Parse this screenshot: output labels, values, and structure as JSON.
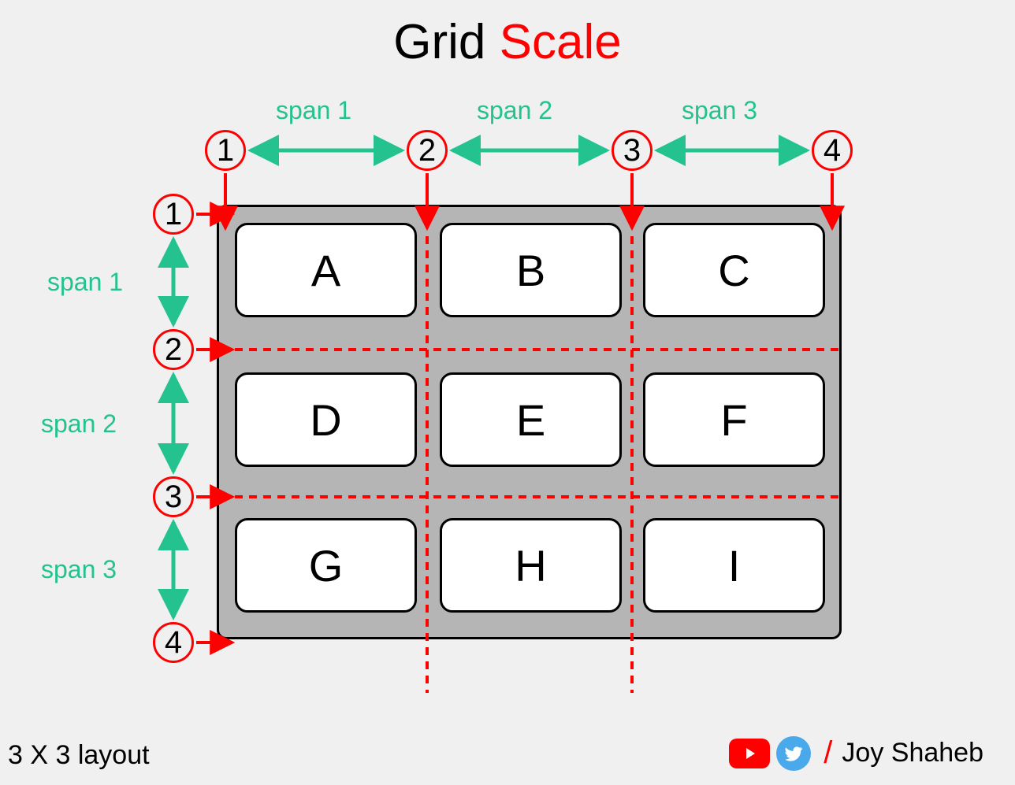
{
  "title": {
    "part1": "Grid",
    "part2": "Scale"
  },
  "columns": {
    "span_labels": [
      "span 1",
      "span 2",
      "span 3"
    ],
    "line_numbers": [
      "1",
      "2",
      "3",
      "4"
    ]
  },
  "rows": {
    "span_labels": [
      "span 1",
      "span 2",
      "span 3"
    ],
    "line_numbers": [
      "1",
      "2",
      "3",
      "4"
    ]
  },
  "cells": [
    "A",
    "B",
    "C",
    "D",
    "E",
    "F",
    "G",
    "H",
    "I"
  ],
  "layout_label": "3 X 3 layout",
  "credit": {
    "name": "Joy Shaheb"
  },
  "colors": {
    "accent_green": "#24c28f",
    "accent_red": "#ff0000",
    "grid_bg": "#b5b5b5"
  }
}
